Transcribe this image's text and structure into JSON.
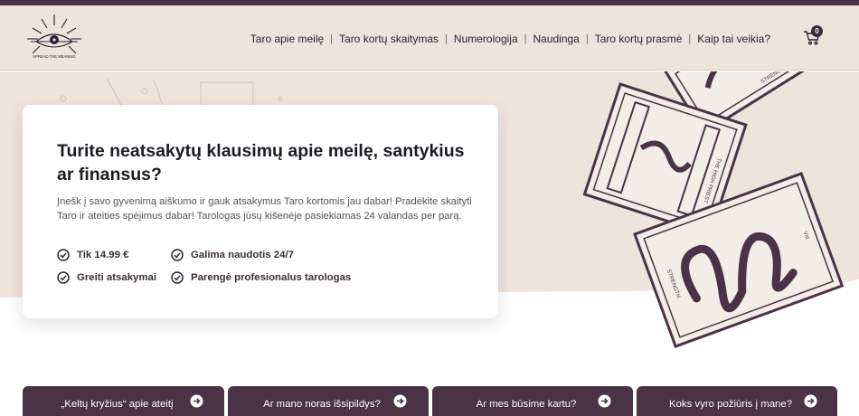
{
  "header": {
    "logo_text": "SPREAD THE MEANING",
    "nav": [
      {
        "label": "Taro apie meilę"
      },
      {
        "label": "Taro kortų skaitymas"
      },
      {
        "label": "Numerologija"
      },
      {
        "label": "Naudinga"
      },
      {
        "label": "Taro kortų prasmė"
      },
      {
        "label": "Kaip tai veikia?"
      }
    ],
    "cart_count": "0"
  },
  "hero": {
    "title": "Turite neatsakytų klausimų apie meilę, santykius ar finansus?",
    "description": "Įnešk į savo gyvenimą aiškumo ir gauk atsakymus Taro kortomis jau dabar! Pradėkite skaityti Taro ir ateities spėjimus dabar! Tarologas jūsų kišenėje pasiekiamas 24 valandas per parą.",
    "features": [
      {
        "label": "Tik 14.99 €"
      },
      {
        "label": "Galima naudotis 24/7"
      },
      {
        "label": "Greiti atsakymai"
      },
      {
        "label": "Parengė profesionalus tarologas"
      }
    ],
    "card_labels": [
      "STRENGTH",
      "THE HIGH PRIEST",
      "STRENGTH",
      "VIII"
    ]
  },
  "buttons": [
    {
      "label": "„Keltų kryžius“ apie ateitį"
    },
    {
      "label": "Ar mano noras išsipildys?"
    },
    {
      "label": "Ar mes būsime kartu?"
    },
    {
      "label": "Koks vyro požiūris į mane?"
    }
  ],
  "colors": {
    "accent": "#4a3247",
    "hero_bg": "#efe4dc"
  }
}
